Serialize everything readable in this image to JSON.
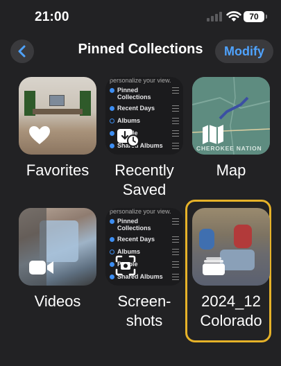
{
  "status_bar": {
    "time": "21:00",
    "battery": "70"
  },
  "nav": {
    "title": "Pinned Collections",
    "modify_label": "Modify",
    "back_icon": "chevron-left-icon"
  },
  "accent_color": "#4fa3ff",
  "highlight_color": "#e6b229",
  "collections": [
    {
      "label": "Favorites",
      "icon": "heart-icon"
    },
    {
      "label_line1": "Recently",
      "label_line2": "Saved",
      "icon": "recently-saved-icon"
    },
    {
      "label": "Map",
      "icon": "map-icon",
      "map_caption": "CHEROKEE NATION"
    },
    {
      "label": "Videos",
      "icon": "video-camera-icon"
    },
    {
      "label_line1": "Screen-",
      "label_line2": "shots",
      "icon": "screenshot-icon"
    },
    {
      "label_line1": "2024_12",
      "label_line2": "Colorado",
      "icon": "album-stack-icon"
    }
  ],
  "settings_thumb": {
    "header": "personalize your view.",
    "items": [
      {
        "label": "Pinned",
        "label2": "Collections",
        "checked": true
      },
      {
        "label": "Recent Days",
        "checked": true
      },
      {
        "label": "Albums",
        "checked": false
      },
      {
        "label": "People",
        "checked": true
      },
      {
        "label": "Shared Albums",
        "checked": true
      }
    ]
  }
}
